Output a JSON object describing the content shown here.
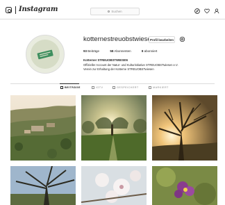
{
  "header": {
    "logo_text": "Instagram",
    "search_placeholder": "Suchen",
    "nav_icons": [
      "compass-icon",
      "heart-icon",
      "user-icon"
    ]
  },
  "profile": {
    "username": "kotternestreuobstwiesen",
    "edit_button": "Profil bearbeiten",
    "stats": {
      "posts_count": "93",
      "posts_label": "Beiträge",
      "followers_count": "58",
      "followers_label": "Abonnenten",
      "following_count": "8",
      "following_label": "abonniert"
    },
    "bio": {
      "name": "Kotterner STREUOBSTWIESEN",
      "line1": "Offizieller Account der Natur- und Kulturinitiative STREUOBSTwiesen e.V.",
      "line2": "Verein zur Erhaltung der Kotterne STREUOBSTwiesen"
    }
  },
  "tabs": [
    {
      "label": "BEITRÄGE",
      "active": true
    },
    {
      "label": "IGTV",
      "active": false
    },
    {
      "label": "GESPEICHERT",
      "active": false
    },
    {
      "label": "MARKIERT",
      "active": false
    }
  ],
  "colors": {
    "border": "#dbdbdb",
    "text": "#262626",
    "muted": "#8e8e8e",
    "profile_green": "#3e8f5f"
  }
}
